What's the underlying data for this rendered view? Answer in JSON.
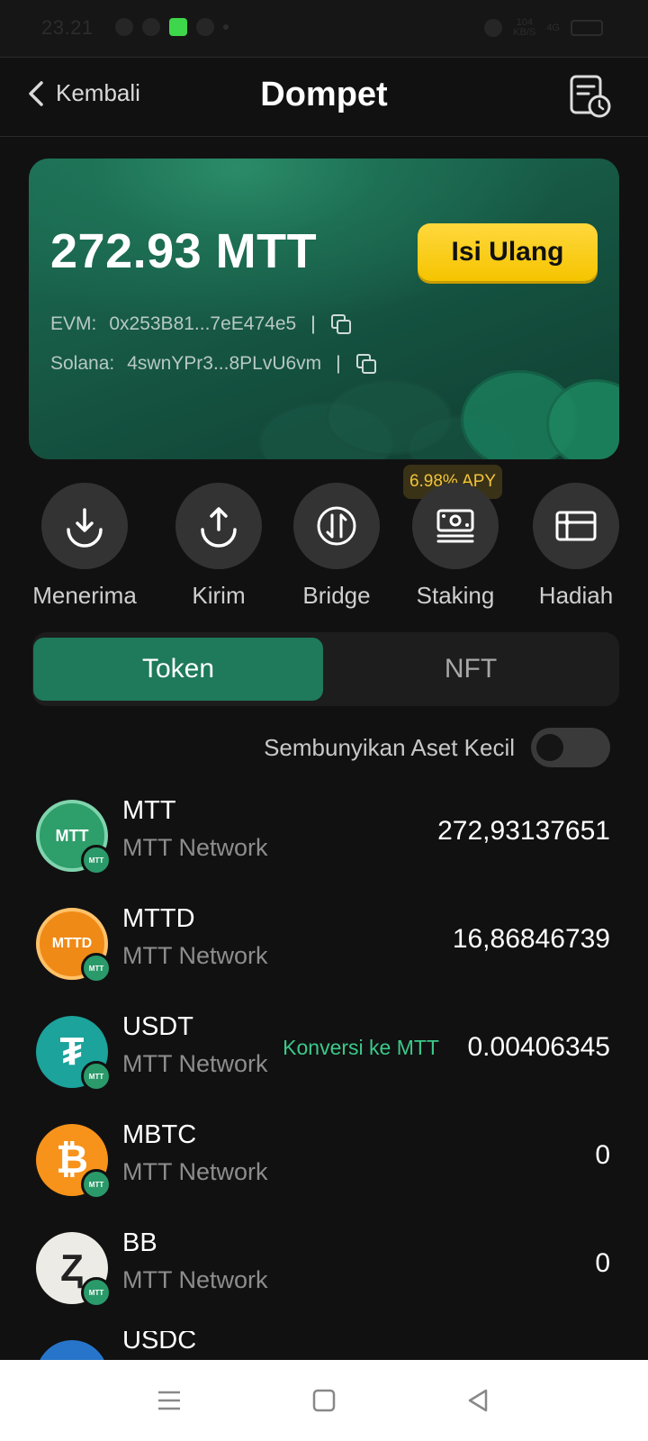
{
  "status_bar": {
    "time": "23.21",
    "speed_top": "104",
    "speed_bottom": "KB/S",
    "network": "4G"
  },
  "header": {
    "back_label": "Kembali",
    "title": "Dompet"
  },
  "card": {
    "balance": "272.93 MTT",
    "topup_label": "Isi Ulang",
    "evm_label": "EVM:",
    "evm_address": "0x253B81...7eE474e5",
    "solana_label": "Solana:",
    "solana_address": "4swnYPr3...8PLvU6vm",
    "separator": "|"
  },
  "actions": {
    "apy_badge": "6.98% APY",
    "items": [
      {
        "label": "Menerima",
        "icon": "receive-icon"
      },
      {
        "label": "Kirim",
        "icon": "send-icon"
      },
      {
        "label": "Bridge",
        "icon": "bridge-icon"
      },
      {
        "label": "Staking",
        "icon": "staking-icon"
      },
      {
        "label": "Hadiah",
        "icon": "gift-card-icon"
      }
    ]
  },
  "tabs": [
    {
      "label": "Token",
      "active": true
    },
    {
      "label": "NFT",
      "active": false
    }
  ],
  "hide_small": {
    "label": "Sembunyikan Aset Kecil",
    "enabled": false
  },
  "tokens": [
    {
      "symbol": "MTT",
      "network": "MTT Network",
      "balance": "272,93137651",
      "logo_text": "MTT",
      "color": "#2e9e6a"
    },
    {
      "symbol": "MTTD",
      "network": "MTT Network",
      "balance": "16,86846739",
      "logo_text": "MTTD",
      "color": "#f08a16"
    },
    {
      "symbol": "USDT",
      "network": "MTT Network",
      "balance": "0.00406345",
      "convert_label": "Konversi ke MTT",
      "logo_text": "₮",
      "color": "#1ba39c"
    },
    {
      "symbol": "MBTC",
      "network": "MTT Network",
      "balance": "0",
      "logo_text": "₿",
      "color": "#f7931a"
    },
    {
      "symbol": "BB",
      "network": "MTT Network",
      "balance": "0",
      "logo_text": "Ⱬ",
      "color": "#ecebe6"
    },
    {
      "symbol": "USDC",
      "network": "",
      "balance": "",
      "logo_text": "",
      "color": "#2775ca"
    }
  ],
  "badge_text": "MTT",
  "colors": {
    "accent": "#1e7a5a",
    "button_yellow": "#f5c400",
    "apy_text": "#f0c43b",
    "convert_text": "#3cc98a"
  }
}
